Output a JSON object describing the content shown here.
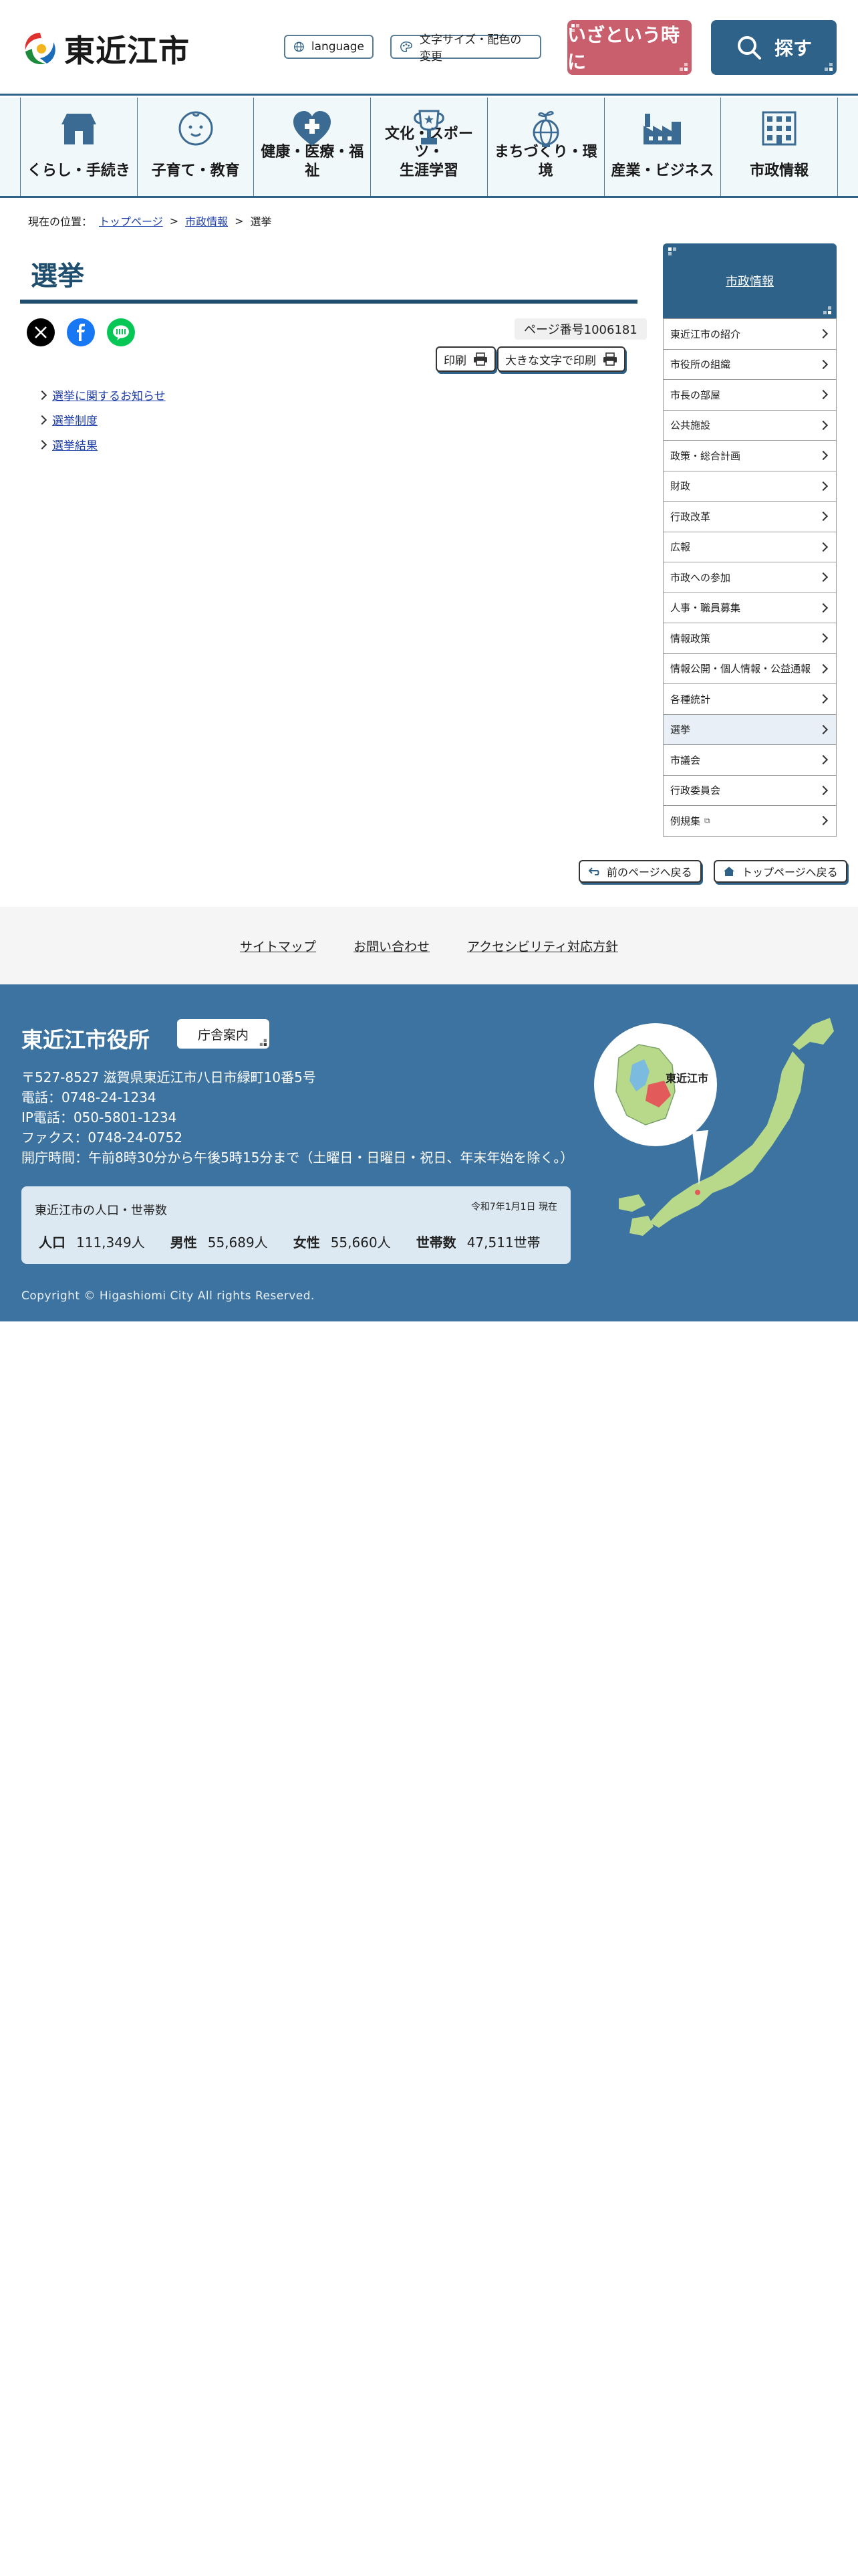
{
  "header": {
    "site_name": "東近江市",
    "language_label": "language",
    "font_color_label": "文字サイズ・配色の変更",
    "emergency_label": "いざという時に",
    "search_label": "探す",
    "colors": {
      "emergency": "#c95f6d",
      "search": "#2f6288"
    }
  },
  "gnav": {
    "items": [
      {
        "label": "くらし・手続き",
        "icon": "house-icon"
      },
      {
        "label": "子育て・教育",
        "icon": "baby-icon"
      },
      {
        "label": "健康・医療・福祉",
        "icon": "heart-plus-icon"
      },
      {
        "label": "文化・スポーツ・\n生涯学習",
        "icon": "trophy-icon"
      },
      {
        "label": "まちづくり・環境",
        "icon": "globe-sprout-icon"
      },
      {
        "label": "産業・ビジネス",
        "icon": "factory-icon"
      },
      {
        "label": "市政情報",
        "icon": "building-icon"
      }
    ]
  },
  "breadcrumb": {
    "prefix": "現在の位置：",
    "items": [
      "トップページ",
      "市政情報",
      "選挙"
    ],
    "separator": ">"
  },
  "main": {
    "title": "選挙",
    "page_number": "ページ番号1006181",
    "print_label": "印刷",
    "print_large_label": "大きな文字で印刷",
    "links": [
      "選挙に関するお知らせ",
      "選挙制度",
      "選挙結果"
    ]
  },
  "side": {
    "heading": "市政情報",
    "items": [
      {
        "label": "東近江市の紹介"
      },
      {
        "label": "市役所の組織"
      },
      {
        "label": "市長の部屋"
      },
      {
        "label": "公共施設"
      },
      {
        "label": "政策・総合計画"
      },
      {
        "label": "財政"
      },
      {
        "label": "行政改革"
      },
      {
        "label": "広報"
      },
      {
        "label": "市政への参加"
      },
      {
        "label": "人事・職員募集"
      },
      {
        "label": "情報政策"
      },
      {
        "label": "情報公開・個人情報・公益通報"
      },
      {
        "label": "各種統計"
      },
      {
        "label": "選挙"
      },
      {
        "label": "市議会"
      },
      {
        "label": "行政委員会"
      },
      {
        "label": "例規集"
      }
    ],
    "active_index": 13
  },
  "back": {
    "prev_label": "前のページへ戻る",
    "top_label": "トップページへ戻る"
  },
  "footer_links": [
    "サイトマップ",
    "お問い合わせ",
    "アクセシビリティ対応方針"
  ],
  "footer": {
    "office_name": "東近江市役所",
    "guide_label": "庁舎案内",
    "postal_address": "〒527-8527  滋賀県東近江市八日市緑町10番5号",
    "tel": "電話：0748-24-1234",
    "ip_tel": "IP電話：050-5801-1234",
    "fax": "ファクス：0748-24-0752",
    "hours": "開庁時間：午前8時30分から午後5時15分まで（土曜日・日曜日・祝日、年末年始を除く。）",
    "map_label": "東近江市",
    "population": {
      "title": "東近江市の人口・世帯数",
      "date": "令和7年1月1日 現在",
      "total_label": "人口",
      "total_value": "111,349人",
      "male_label": "男性",
      "male_value": "55,689人",
      "female_label": "女性",
      "female_value": "55,660人",
      "households_label": "世帯数",
      "households_value": "47,511世帯"
    },
    "copyright": "Copyright © Higashiomi City All rights Reserved."
  }
}
